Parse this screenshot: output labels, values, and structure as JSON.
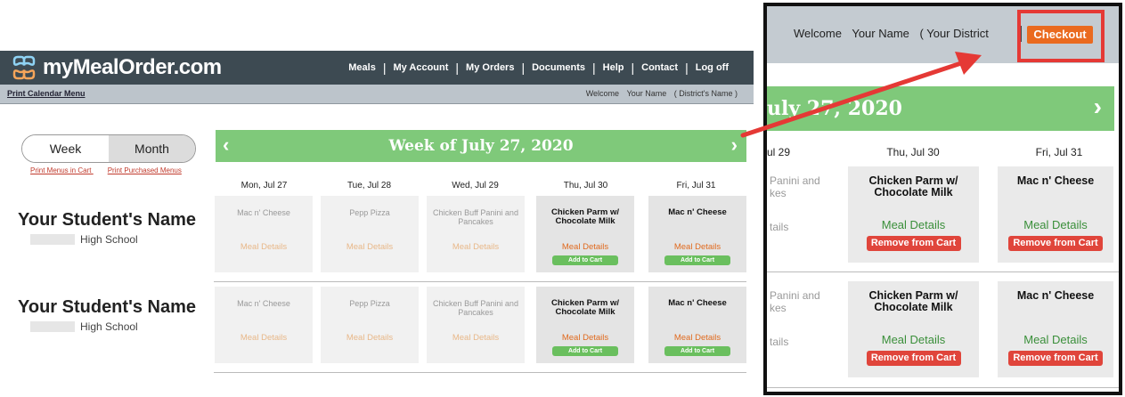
{
  "left": {
    "brand": "myMealOrder.com",
    "nav": [
      "Meals",
      "My Account",
      "My Orders",
      "Documents",
      "Help",
      "Contact",
      "Log off"
    ],
    "print_calendar": "Print Calendar Menu",
    "welcome": "Welcome",
    "your_name": "Your Name",
    "district": "( District's Name )",
    "toggle": {
      "week": "Week",
      "month": "Month"
    },
    "print_links": [
      "Print Menus in Cart",
      "Print Purchased Menus"
    ],
    "week_title": "Week of July 27, 2020",
    "days": [
      "Mon, Jul 27",
      "Tue, Jul 28",
      "Wed, Jul 29",
      "Thu, Jul 30",
      "Fri, Jul 31"
    ],
    "students": [
      {
        "name": "Your Student's Name",
        "school": "High School",
        "meals": [
          "Mac n' Cheese",
          "Pepp Pizza",
          "Chicken Buff Panini and Pancakes",
          "Chicken Parm w/ Chocolate Milk",
          "Mac n' Cheese"
        ]
      },
      {
        "name": "Your Student's Name",
        "school": "High School",
        "meals": [
          "Mac n' Cheese",
          "Pepp Pizza",
          "Chicken Buff Panini and Pancakes",
          "Chicken Parm w/ Chocolate Milk",
          "Mac n' Cheese"
        ]
      }
    ],
    "meal_details": "Meal Details",
    "add_to_cart": "Add to Cart"
  },
  "zoom": {
    "welcome": "Welcome",
    "your_name": "Your Name",
    "district": "( Your District",
    "checkout": "Checkout",
    "week_fragment": "uly 27, 2020",
    "days": [
      "ul 29",
      "Thu, Jul 30",
      "Fri, Jul 31"
    ],
    "partial_meal_1": "Panini and",
    "partial_meal_2": "kes",
    "partial_details": "tails",
    "meals": [
      "Chicken Parm w/ Chocolate Milk",
      "Mac n' Cheese"
    ],
    "meal_details": "Meal Details",
    "remove_from_cart": "Remove from Cart"
  },
  "colors": {
    "topbar": "#3d4a52",
    "week_green": "#7fc97a",
    "checkout_orange": "#ea6a1f",
    "remove_red": "#e0453b",
    "callout_red": "#e53935"
  }
}
